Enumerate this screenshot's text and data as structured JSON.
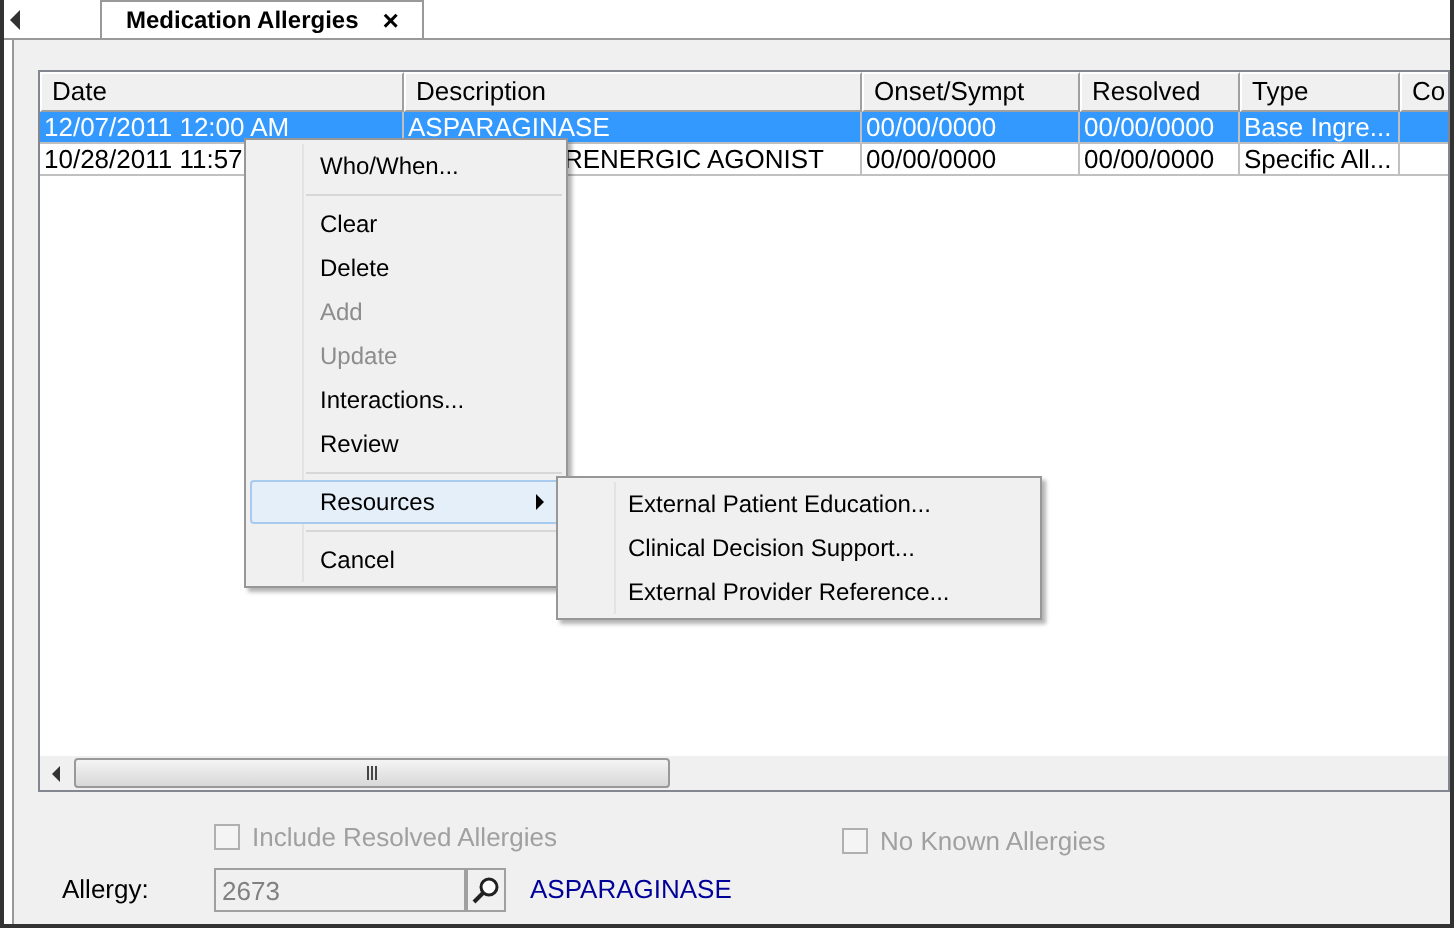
{
  "tab": {
    "label": "Medication Allergies",
    "close": "×",
    "selected": true
  },
  "table": {
    "columns": [
      "Date",
      "Description",
      "Onset/Sympt",
      "Resolved",
      "Type",
      "Co"
    ],
    "rows": [
      {
        "selected": true,
        "cut_left": false,
        "cells": [
          "12/07/2011 12:00 AM",
          "ASPARAGINASE",
          "00/00/0000",
          "00/00/0000",
          "Base Ingre...",
          ""
        ]
      },
      {
        "selected": false,
        "cut_left": true,
        "cells": [
          "10/28/2011 11:57",
          "RENERGIC AGONIST",
          "00/00/0000",
          "00/00/0000",
          "Specific All...",
          ""
        ]
      }
    ]
  },
  "context_menu": {
    "items": [
      {
        "kind": "item",
        "label": "Who/When...",
        "disabled": false,
        "selected": false
      },
      {
        "kind": "separator"
      },
      {
        "kind": "item",
        "label": "Clear",
        "disabled": false,
        "selected": false
      },
      {
        "kind": "item",
        "label": "Delete",
        "disabled": false,
        "selected": false
      },
      {
        "kind": "item",
        "label": "Add",
        "disabled": true,
        "selected": false
      },
      {
        "kind": "item",
        "label": "Update",
        "disabled": true,
        "selected": false
      },
      {
        "kind": "item",
        "label": "Interactions...",
        "disabled": false,
        "selected": false
      },
      {
        "kind": "item",
        "label": "Review",
        "disabled": false,
        "selected": false
      },
      {
        "kind": "separator"
      },
      {
        "kind": "submenu",
        "label": "Resources",
        "disabled": false,
        "selected": true
      },
      {
        "kind": "separator"
      },
      {
        "kind": "item",
        "label": "Cancel",
        "disabled": false,
        "selected": false
      }
    ]
  },
  "submenu": {
    "items": [
      "External Patient Education...",
      "Clinical Decision Support...",
      "External Provider Reference..."
    ]
  },
  "options": [
    {
      "label": "Include Resolved Allergies",
      "checked": false,
      "disabled": true
    },
    {
      "label": "No Known Allergies",
      "checked": false,
      "disabled": true
    }
  ],
  "allergy": {
    "label": "Allergy:",
    "value": "2673",
    "name": "ASPARAGINASE"
  }
}
